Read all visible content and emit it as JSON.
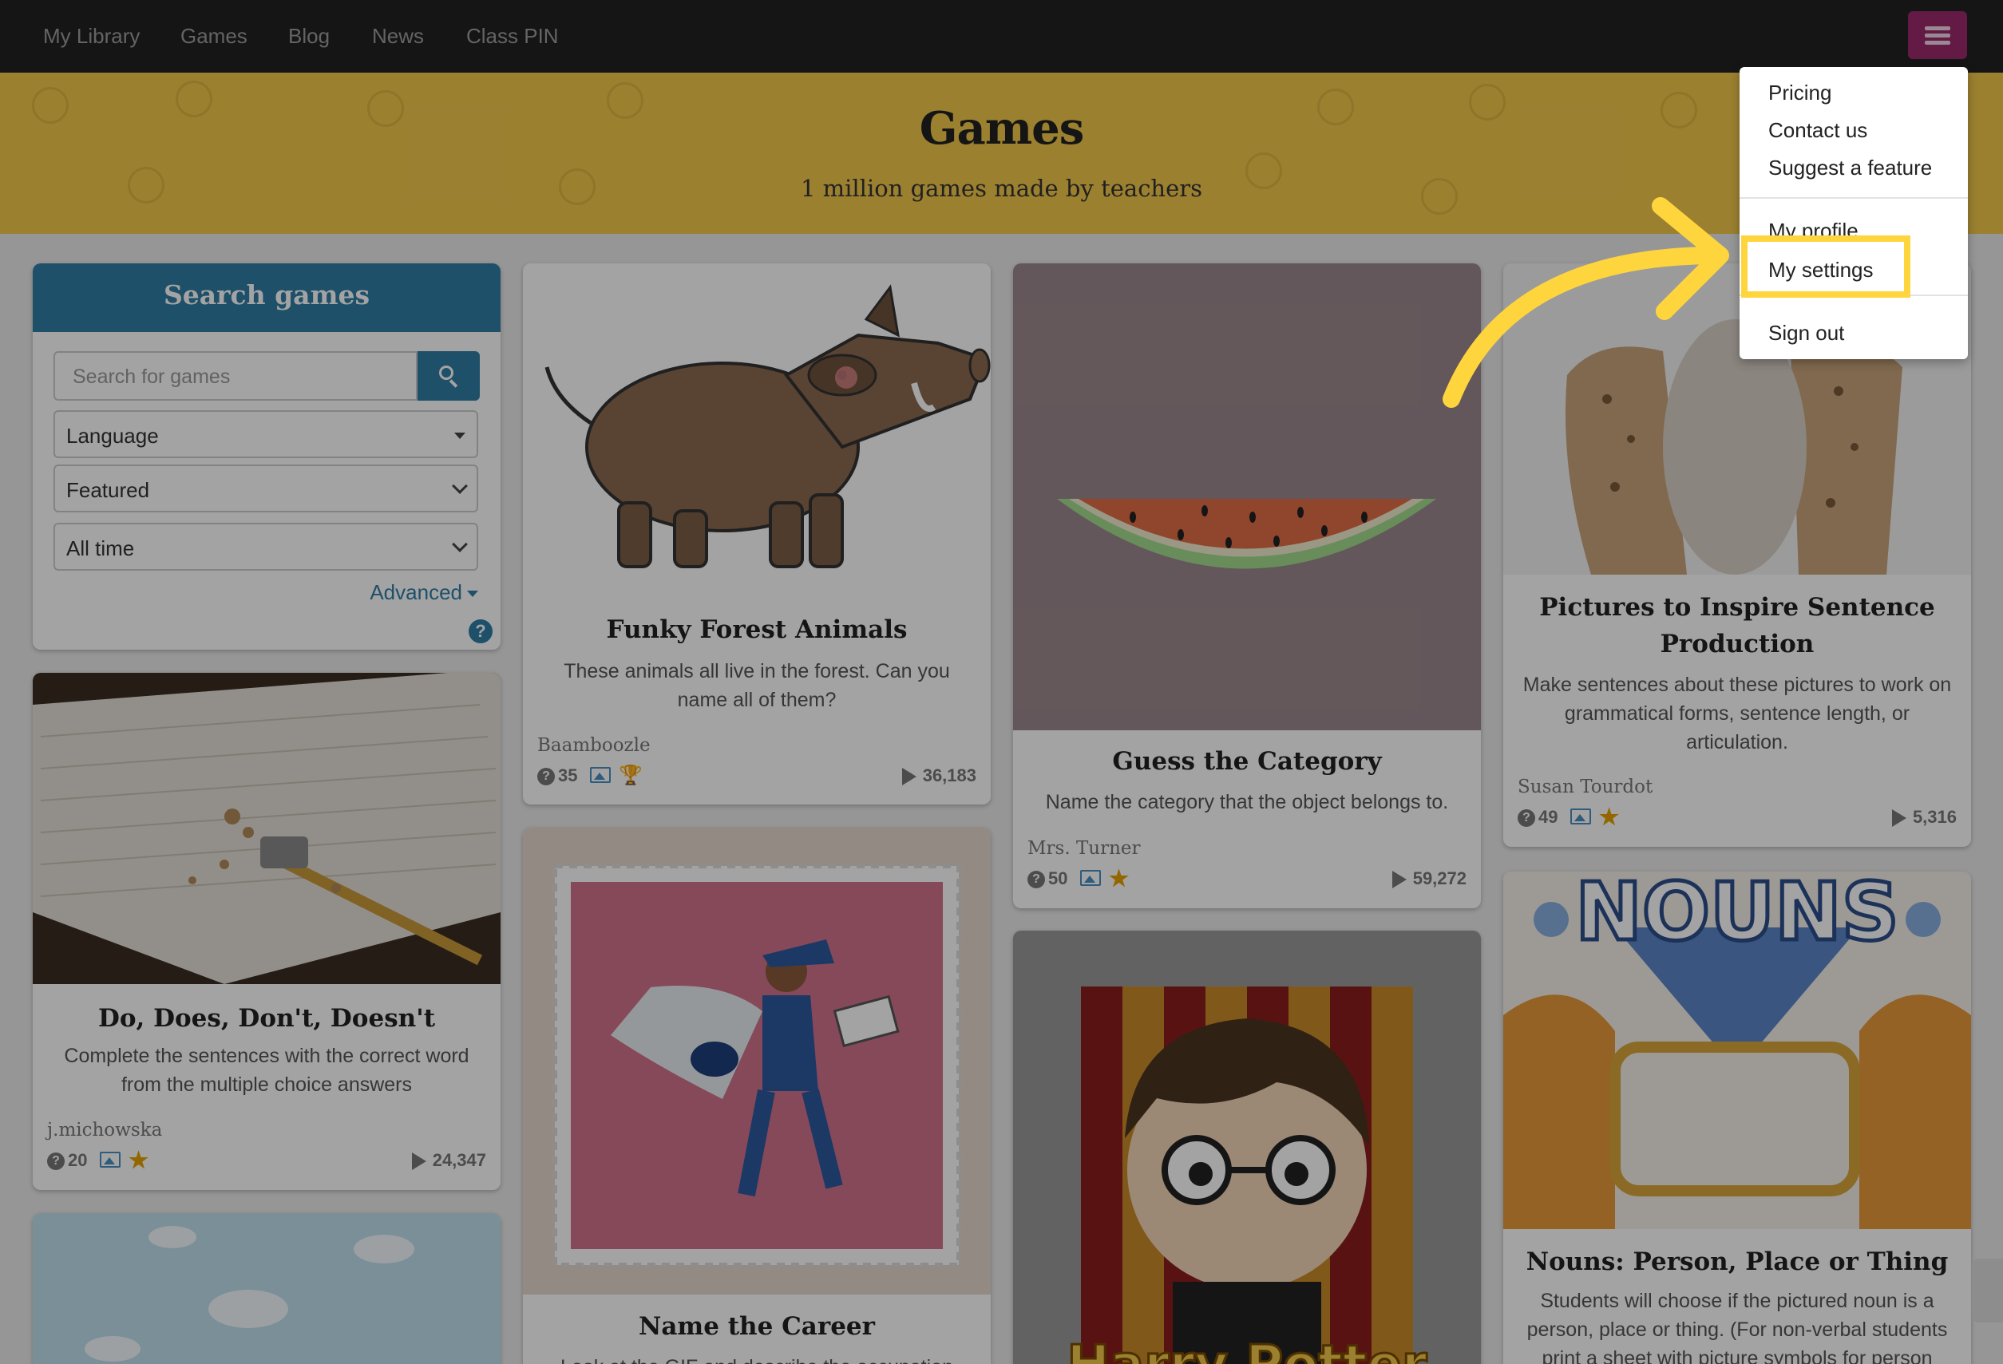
{
  "nav": {
    "links": [
      "My Library",
      "Games",
      "Blog",
      "News",
      "Class PIN"
    ],
    "menu_icon": "hamburger-icon"
  },
  "banner": {
    "title": "Games",
    "subtitle": "1 million games made by teachers"
  },
  "search": {
    "title": "Search games",
    "placeholder": "Search for games",
    "language": "Language",
    "sort": "Featured",
    "time": "All time",
    "advanced": "Advanced",
    "help": "?"
  },
  "games": [
    {
      "title": "Funky Forest Animals",
      "desc": "These animals all live in the forest. Can you name all of them?",
      "author": "Baamboozle",
      "questions": "35",
      "plays": "36,183"
    },
    {
      "title": "Guess the Category",
      "desc": "Name the category that the object belongs to.",
      "author": "Mrs. Turner",
      "questions": "50",
      "plays": "59,272"
    },
    {
      "title": "Pictures to Inspire Sentence Production",
      "desc": "Make sentences about these pictures to work on grammatical forms, sentence length, or articulation.",
      "author": "Susan Tourdot",
      "questions": "49",
      "plays": "5,316"
    },
    {
      "title": "Do, Does, Don't, Doesn't",
      "desc": "Complete the sentences with the correct word from the multiple choice answers",
      "author": "j.michowska",
      "questions": "20",
      "plays": "24,347"
    },
    {
      "title": "Name the Career",
      "desc": "Look at the GIF and describe the occupation"
    },
    {
      "title": "Nouns: Person, Place or Thing",
      "desc": "Students will choose if the pictured noun is a person, place or thing. (For non-verbal students print a sheet with picture symbols for person"
    }
  ],
  "images": {
    "nouns_text": "NOUNS",
    "harry_text": "Harry Potter"
  },
  "menu": {
    "pricing": "Pricing",
    "contact": "Contact us",
    "suggest": "Suggest a feature",
    "profile": "My profile",
    "settings": "My settings",
    "signout": "Sign out"
  },
  "colors": {
    "nav_bg": "#222222",
    "banner": "#f2c94c",
    "accent": "#2f7ea6",
    "menu_button": "#9b2a6c",
    "highlight": "#ffd53d"
  }
}
